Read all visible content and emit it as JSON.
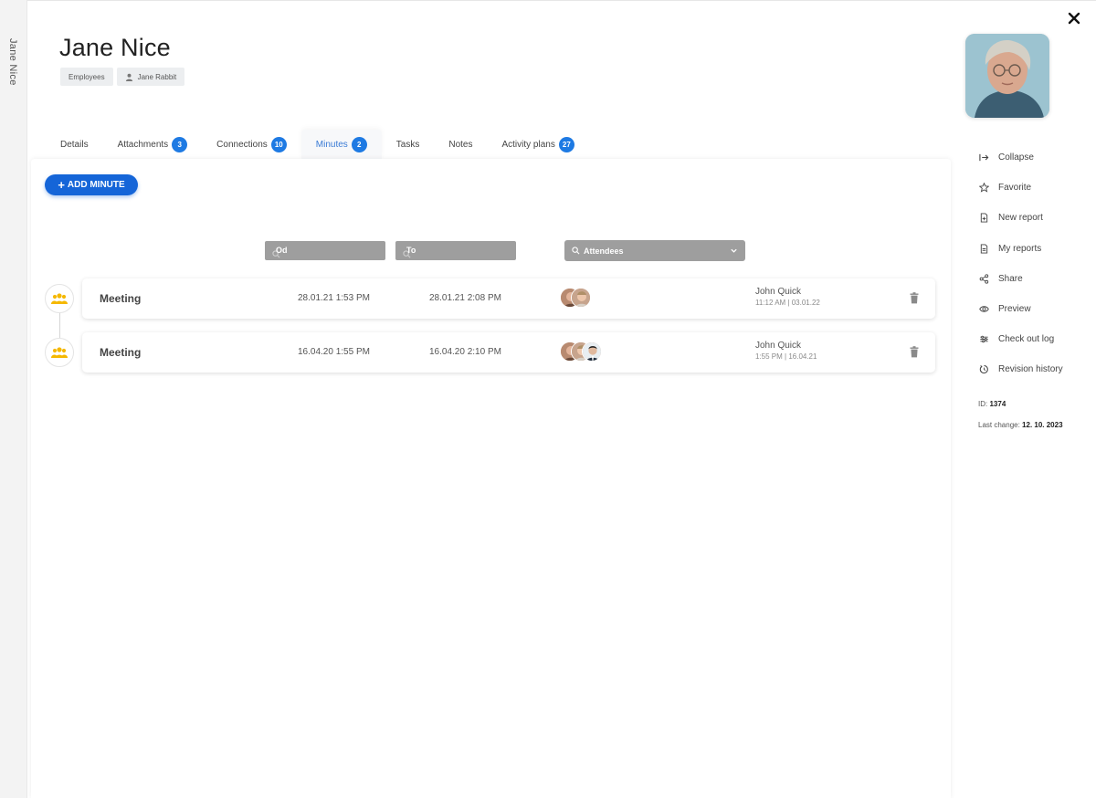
{
  "sidebar": {
    "collapsed_label": "Jane Nice"
  },
  "header": {
    "title": "Jane Nice",
    "chips": [
      {
        "label": "Employees"
      },
      {
        "label": "Jane Rabbit",
        "icon": "person-icon"
      }
    ]
  },
  "tabs": [
    {
      "label": "Details",
      "badge": null
    },
    {
      "label": "Attachments",
      "badge": "3"
    },
    {
      "label": "Connections",
      "badge": "10"
    },
    {
      "label": "Minutes",
      "badge": "2",
      "active": true
    },
    {
      "label": "Tasks",
      "badge": null
    },
    {
      "label": "Notes",
      "badge": null
    },
    {
      "label": "Activity plans",
      "badge": "27"
    }
  ],
  "toolbar": {
    "add_label": "ADD MINUTE"
  },
  "filters": {
    "from_placeholder": "Od",
    "to_placeholder": "To",
    "attendees_placeholder": "Attendees"
  },
  "minutes": [
    {
      "title": "Meeting",
      "from": "28.01.21 1:53 PM",
      "to": "28.01.21 2:08 PM",
      "attendee_count": 2,
      "user": "John Quick",
      "user_time": "11:12 AM | 03.01.22"
    },
    {
      "title": "Meeting",
      "from": "16.04.20 1:55 PM",
      "to": "16.04.20 2:10 PM",
      "attendee_count": 3,
      "user": "John Quick",
      "user_time": "1:55 PM | 16.04.21"
    }
  ],
  "right_menu": [
    {
      "label": "Collapse",
      "icon": "collapse-icon"
    },
    {
      "label": "Favorite",
      "icon": "star-icon"
    },
    {
      "label": "New report",
      "icon": "new-report-icon"
    },
    {
      "label": "My reports",
      "icon": "report-icon"
    },
    {
      "label": "Share",
      "icon": "share-icon"
    },
    {
      "label": "Preview",
      "icon": "eye-icon"
    },
    {
      "label": "Check out log",
      "icon": "checkout-log-icon"
    },
    {
      "label": "Revision history",
      "icon": "history-icon"
    }
  ],
  "meta": {
    "id_label": "ID:",
    "id_value": "1374",
    "last_change_label": "Last change:",
    "last_change_value": "12. 10. 2023"
  },
  "colors": {
    "accent": "#1565d8",
    "badge": "#1e7ae3",
    "filter_bg": "#9e9e9e",
    "meeting_icon": "#f5b800"
  }
}
